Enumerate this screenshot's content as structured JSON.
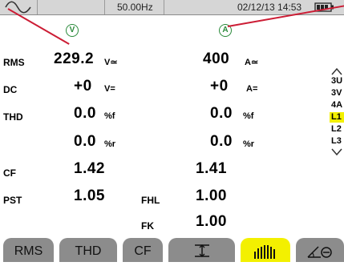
{
  "status_bar": {
    "frequency": "50.00Hz",
    "datetime": "02/12/13  14:53"
  },
  "channels": {
    "voltage_symbol": "V",
    "current_symbol": "A"
  },
  "rows": [
    {
      "label": "RMS",
      "v_value": "229.2",
      "v_unit": "V≃",
      "a_value": "400",
      "a_unit": "A≃"
    },
    {
      "label": "DC",
      "v_value": "+0",
      "v_unit": "V=",
      "a_value": "+0",
      "a_unit": "A="
    },
    {
      "label": "THD",
      "v_value": "0.0",
      "v_unit": "%f",
      "a_value": "0.0",
      "a_unit": "%f"
    },
    {
      "label": "",
      "v_value": "0.0",
      "v_unit": "%r",
      "a_value": "0.0",
      "a_unit": "%r"
    },
    {
      "label": "CF",
      "v_value": "1.42",
      "v_unit": "",
      "a_value": "1.41",
      "a_unit": ""
    },
    {
      "label": "PST",
      "v_value": "1.05",
      "v_unit": "",
      "mid_label": "FHL",
      "a_value": "1.00",
      "a_unit": ""
    },
    {
      "label": "",
      "v_value": "",
      "v_unit": "",
      "mid_label": "FK",
      "a_value": "1.00",
      "a_unit": ""
    }
  ],
  "selector": {
    "items": [
      "3U",
      "3V",
      "4A",
      "L1",
      "L2",
      "L3"
    ],
    "active": "L1"
  },
  "tabs": [
    "RMS",
    "THD",
    "CF",
    "↕",
    "",
    "∠⊖"
  ],
  "active_tab_index": 4,
  "colors": {
    "accent_green": "#2a8a3a",
    "active_yellow": "#f3f000",
    "tab_gray": "#8c8c8c",
    "callout_red": "#cc1d35"
  }
}
